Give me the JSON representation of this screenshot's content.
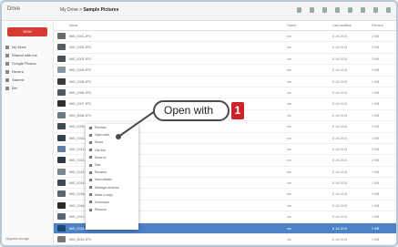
{
  "topbar": {
    "app": "Drive",
    "path": "My Drive",
    "folder": "Sample Pictures"
  },
  "sidebar": {
    "new_label": "NEW",
    "items": [
      "My Drive",
      "Shared with me",
      "Google Photos",
      "Recent",
      "Starred",
      "Bin"
    ],
    "storage": "Upgrade storage"
  },
  "columns": {
    "name": "Name",
    "owner": "Owner",
    "modified": "Last modified",
    "size": "File size"
  },
  "rows": [
    {
      "name": "IMG_0001.JPG",
      "owner": "me",
      "modified": "8 Jul 2015",
      "size": "2 MB",
      "color": "#6a6a6a"
    },
    {
      "name": "IMG_0002.JPG",
      "owner": "me",
      "modified": "8 Jul 2015",
      "size": "2 MB",
      "color": "#555e66"
    },
    {
      "name": "IMG_0003.JPG",
      "owner": "me",
      "modified": "8 Jul 2015",
      "size": "3 MB",
      "color": "#48505a"
    },
    {
      "name": "IMG_0004.JPG",
      "owner": "me",
      "modified": "8 Jul 2015",
      "size": "2 MB",
      "color": "#8a98a6"
    },
    {
      "name": "IMG_0005.JPG",
      "owner": "me",
      "modified": "8 Jul 2015",
      "size": "1 MB",
      "color": "#3c3c3c"
    },
    {
      "name": "IMG_0006.JPG",
      "owner": "me",
      "modified": "8 Jul 2015",
      "size": "1 MB",
      "color": "#4e5a64"
    },
    {
      "name": "IMG_0007.JPG",
      "owner": "me",
      "modified": "8 Jul 2015",
      "size": "1 MB",
      "color": "#2f2f2f"
    },
    {
      "name": "IMG_0008.JPG",
      "owner": "me",
      "modified": "8 Jul 2015",
      "size": "1 MB",
      "color": "#6d7b86"
    },
    {
      "name": "IMG_0009.JPG",
      "owner": "me",
      "modified": "8 Jul 2015",
      "size": "2 MB",
      "color": "#3d4b58"
    },
    {
      "name": "IMG_0010.JPG",
      "owner": "me",
      "modified": "8 Jul 2015",
      "size": "1 MB",
      "color": "#34424e"
    },
    {
      "name": "IMG_0011.JPG",
      "owner": "me",
      "modified": "8 Jul 2015",
      "size": "2 MB",
      "color": "#5d7fa6"
    },
    {
      "name": "IMG_0012.JPG",
      "owner": "me",
      "modified": "8 Jul 2015",
      "size": "2 MB",
      "color": "#2c3a48"
    },
    {
      "name": "IMG_0013.JPG",
      "owner": "me",
      "modified": "8 Jul 2015",
      "size": "1 MB",
      "color": "#7a8794"
    },
    {
      "name": "IMG_0014.JPG",
      "owner": "me",
      "modified": "8 Jul 2015",
      "size": "1 MB",
      "color": "#404a52"
    },
    {
      "name": "IMG_0015.JPG",
      "owner": "me",
      "modified": "8 Jul 2015",
      "size": "2 MB",
      "color": "#5a6670"
    },
    {
      "name": "IMG_0016.JPG",
      "owner": "me",
      "modified": "8 Jul 2015",
      "size": "1 MB",
      "color": "#2a2a2a"
    },
    {
      "name": "IMG_0017.JPG",
      "owner": "me",
      "modified": "8 Jul 2015",
      "size": "1 MB",
      "color": "#556677"
    },
    {
      "name": "IMG_0018.JPG",
      "owner": "me",
      "modified": "8 Jul 2015",
      "size": "2 MB",
      "color": "#20466e",
      "selected": true
    },
    {
      "name": "IMG_0019.JPG",
      "owner": "me",
      "modified": "8 Jul 2015",
      "size": "1 MB",
      "color": "#777777"
    }
  ],
  "context_menu": [
    "Preview",
    "Open with",
    "Share",
    "Get link",
    "Move to",
    "Star",
    "Rename",
    "View details",
    "Manage versions",
    "Make a copy",
    "Download",
    "Remove"
  ],
  "callout": {
    "text": "Open with",
    "badge": "1"
  }
}
